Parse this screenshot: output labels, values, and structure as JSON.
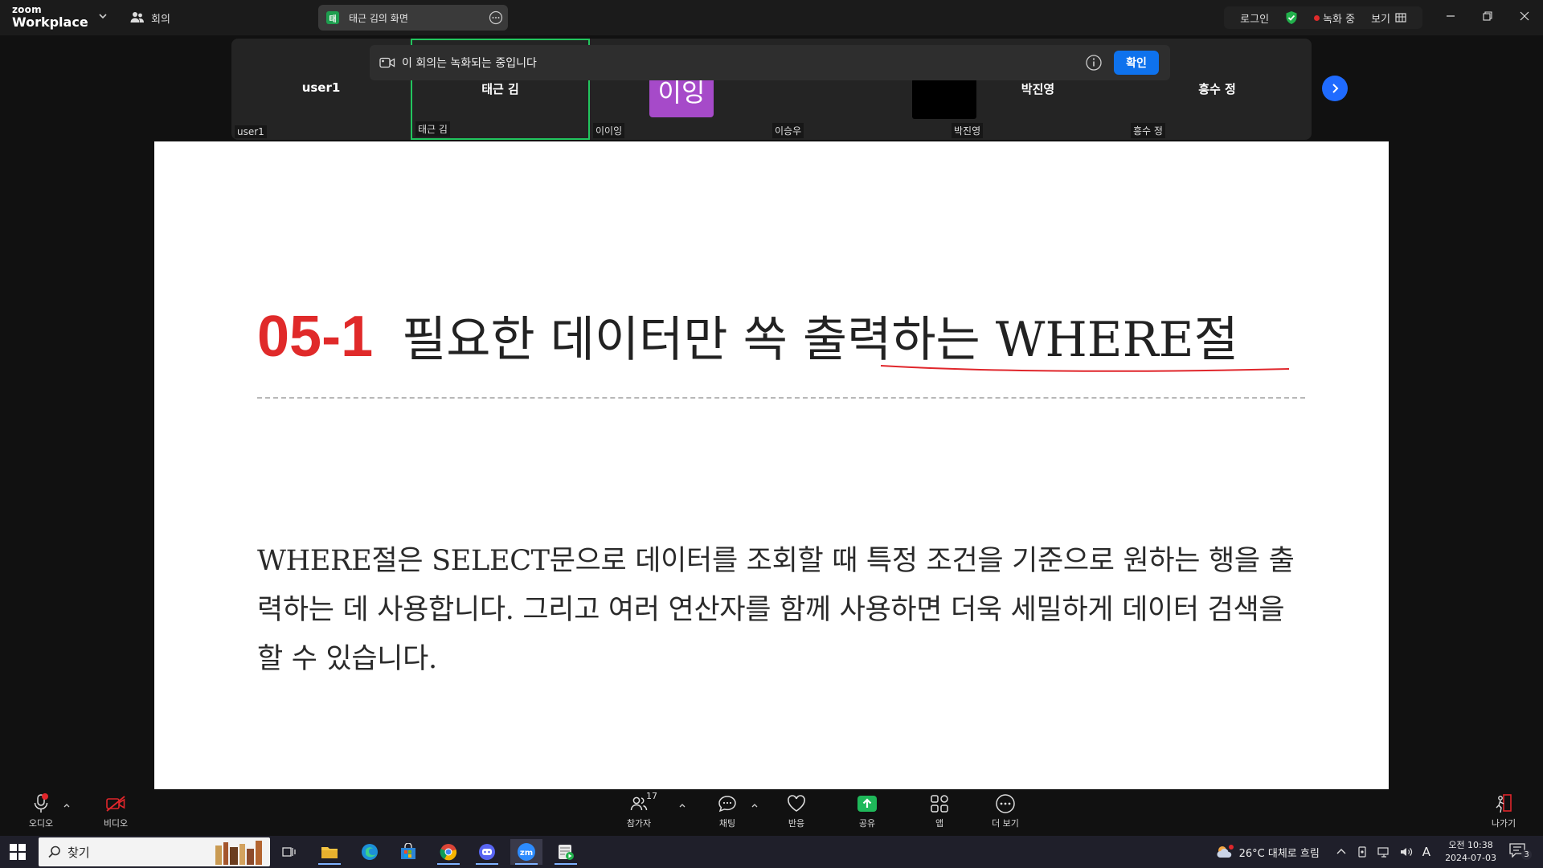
{
  "app": {
    "brand_top": "zoom",
    "brand_bottom": "Workplace",
    "meeting_label": "회의"
  },
  "share_pill": {
    "badge": "태",
    "label": "태근 김의 화면"
  },
  "top_right": {
    "login": "로그인",
    "recording": "녹화 중",
    "view": "보기"
  },
  "banner": {
    "text": "이 회의는 녹화되는 중입니다",
    "confirm": "확인"
  },
  "participants": [
    {
      "center": "user1",
      "tag": "user1"
    },
    {
      "center": "태근 김",
      "tag": "태근 김"
    },
    {
      "avatar": "이잉",
      "tag": "이이잉"
    },
    {
      "tag": "이승우"
    },
    {
      "center": "박진영",
      "tag": "박진영"
    },
    {
      "center": "흥수 정",
      "tag": "흥수 정"
    }
  ],
  "slide": {
    "number": "05-1",
    "heading": "필요한 데이터만 쏙 출력하는 WHERE절",
    "body": "WHERE절은 SELECT문으로 데이터를 조회할 때 특정 조건을 기준으로 원하는 행을 출력하는 데 사용합니다. 그리고 여러 연산자를 함께 사용하면 더욱 세밀하게 데이터 검색을 할 수 있습니다."
  },
  "controls": {
    "audio": "오디오",
    "video": "비디오",
    "participants": "참가자",
    "participants_count": "17",
    "chat": "채팅",
    "reactions": "반응",
    "share": "공유",
    "apps": "앱",
    "more": "더 보기",
    "leave": "나가기"
  },
  "taskbar": {
    "search": "찾기",
    "weather": "26°C 대체로 흐림",
    "ime": "A",
    "time": "오전 10:38",
    "date": "2024-07-03",
    "notifications": "3"
  },
  "colors": {
    "accent": "#0e72ed",
    "active_border": "#22c55e",
    "record": "#e02b2b",
    "slide_number": "#e02a2a",
    "share_green": "#1e9e4f"
  }
}
